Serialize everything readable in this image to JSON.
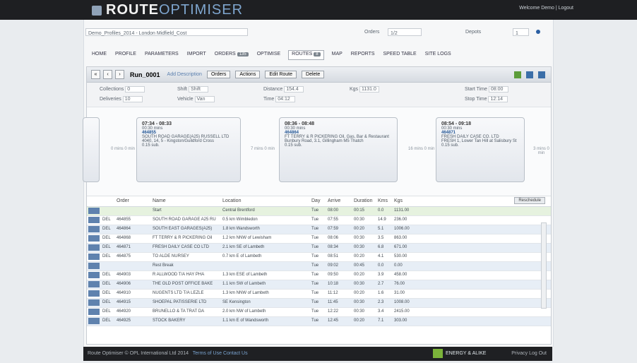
{
  "header": {
    "brand_main": "ROUTE",
    "brand_sub": "OPTIMISER",
    "user_links": "Welcome Demo | Logout"
  },
  "filters": {
    "profile": "Demo_Profiles_2014 - London Midfield_Cost",
    "orders_label": "Orders",
    "orders_value": "1/2",
    "depot_label": "Depots",
    "depot_value": "1"
  },
  "nav": {
    "items": [
      "HOME",
      "PROFILE",
      "PARAMETERS",
      "IMPORT",
      "ORDERS",
      "OPTIMISE",
      "ROUTES",
      "MAP",
      "REPORTS",
      "SPEED TABLE",
      "SITE LOGS"
    ],
    "orders_badge": "135",
    "routes_badge": "8"
  },
  "toolbar": {
    "nav_prev_first": "«",
    "nav_prev": "‹",
    "nav_next": "›",
    "route_title": "Run_0001",
    "sub": "Add Description",
    "buttons": [
      "Orders",
      "Actions",
      "Edit Route",
      "Delete"
    ]
  },
  "summary": {
    "collections_label": "Collections",
    "collections_value": "0",
    "deliveries_label": "Deliveries",
    "deliveries_value": "10",
    "shift_label": "Shift",
    "shift_value": "Shift",
    "vehicle_label": "Vehicle",
    "vehicle_value": "Van",
    "distance_label": "Distance",
    "distance_value": "154.4",
    "time_label": "Time",
    "time_value": "04:12",
    "kgs_label": "Kgs",
    "kgs_value": "1131.0",
    "start_label": "Start Time",
    "start_value": "08:00",
    "stop_label": "Stop Time",
    "stop_value": "12:14"
  },
  "timeline": {
    "stops": [
      {
        "time": "07:34 - 08:33",
        "dur": "00:30 mins",
        "ref": "464855",
        "line1": "SOUTH ROAD GARAGE(A25) RUSSELL LTD",
        "line2": "4040, 14, 5 - Kingston/Guildford Cross",
        "line3": "0.15 sub."
      },
      {
        "time": "08:36 - 08:48",
        "dur": "00:30 mins",
        "ref": "464864",
        "line1": "FT TERRY & R PICKERING Oil, Gas, Bar & Restaurant",
        "line2": "Bunbury Road, 3.1, Gillingham M5 Thatch",
        "line3": "0.15 sub."
      },
      {
        "time": "08:54 - 09:18",
        "dur": "00:30 mins",
        "ref": "464871",
        "line1": "FRESH DAILY CASE CO. LTD",
        "line2": "FRESH 1, Lower Tan Hill at Salisbury St",
        "line3": "0.15 sub."
      }
    ],
    "connectors": [
      "0 mins 0 min",
      "7 mins 0 min",
      "16 mins 0 min",
      "3 mins 0 min"
    ]
  },
  "grid": {
    "headers": [
      "Order",
      "Name",
      "Location",
      "Day",
      "Arrive",
      "Duration",
      "Kms",
      "Kgs"
    ],
    "reschedule": "Reschedule",
    "rows": [
      {
        "type": "",
        "order": "",
        "name": "Start",
        "loc": "Central Brentford",
        "day": "Tue",
        "arrive": "08:00",
        "dur": "00:15",
        "kms": "0.0",
        "kgs": "1131.00"
      },
      {
        "type": "DEL",
        "order": "464855",
        "name": "SOUTH ROAD GARAGE A25 RU",
        "loc": "0.5 km Wimbledon",
        "day": "Tue",
        "arrive": "07:55",
        "dur": "00:30",
        "kms": "14.9",
        "kgs": "236.00"
      },
      {
        "type": "DEL",
        "order": "464864",
        "name": "SOUTH EAST GARAGES(A25)",
        "loc": "1.8 km Wandsworth",
        "day": "Tue",
        "arrive": "07:59",
        "dur": "00:20",
        "kms": "5.1",
        "kgs": "1006.00"
      },
      {
        "type": "DEL",
        "order": "464868",
        "name": "FT TERRY & R PICKERING Oil",
        "loc": "1.2 km NNW of Lewisham",
        "day": "Tue",
        "arrive": "08:06",
        "dur": "00:30",
        "kms": "3.5",
        "kgs": "863.00"
      },
      {
        "type": "DEL",
        "order": "464871",
        "name": "FRESH DAILY CASE CO LTD",
        "loc": "2.1 km SE of Lambeth",
        "day": "Tue",
        "arrive": "08:34",
        "dur": "00:30",
        "kms": "6.8",
        "kgs": "671.00"
      },
      {
        "type": "DEL",
        "order": "464875",
        "name": "TO ALDE NURSEY",
        "loc": "0.7 km E of Lambeth",
        "day": "Tue",
        "arrive": "08:51",
        "dur": "00:20",
        "kms": "4.1",
        "kgs": "530.00"
      },
      {
        "type": "",
        "order": "",
        "name": "Rest Break",
        "loc": "",
        "day": "Tue",
        "arrive": "09:02",
        "dur": "00:45",
        "kms": "0.0",
        "kgs": "0.00"
      },
      {
        "type": "DEL",
        "order": "464903",
        "name": "R ALLWOOD T/A HAY PHA",
        "loc": "1.3 km ESE of Lambeth",
        "day": "Tue",
        "arrive": "09:50",
        "dur": "00:20",
        "kms": "3.9",
        "kgs": "458.00"
      },
      {
        "type": "DEL",
        "order": "464906",
        "name": "THE OLD POST OFFICE BAKE",
        "loc": "1.1 km SW of Lambeth",
        "day": "Tue",
        "arrive": "10:18",
        "dur": "00:30",
        "kms": "2.7",
        "kgs": "76.00"
      },
      {
        "type": "DEL",
        "order": "464910",
        "name": "NUGENTS LTD T/A LEZLE",
        "loc": "1.3 km NNW of Lambeth",
        "day": "Tue",
        "arrive": "11:12",
        "dur": "00:20",
        "kms": "1.6",
        "kgs": "31.00"
      },
      {
        "type": "DEL",
        "order": "464915",
        "name": "SHOEPAL PATISSERIE LTD",
        "loc": "SE Kensington",
        "day": "Tue",
        "arrive": "11:45",
        "dur": "00:30",
        "kms": "2.3",
        "kgs": "1008.00"
      },
      {
        "type": "DEL",
        "order": "464920",
        "name": "BRUNELLO & TA TRAT DA",
        "loc": "2.0 km NW of Lambeth",
        "day": "Tue",
        "arrive": "12:22",
        "dur": "00:30",
        "kms": "3.4",
        "kgs": "2415.00"
      },
      {
        "type": "DEL",
        "order": "464925",
        "name": "STOCK BAKERY",
        "loc": "1.1 km E of Wandsworth",
        "day": "Tue",
        "arrive": "12:45",
        "dur": "00:20",
        "kms": "7.1",
        "kgs": "303.00"
      }
    ]
  },
  "footer": {
    "copyright": "Route Optimiser © OPL International Ltd 2014",
    "links": "Terms of Use  Contact Us",
    "cert": "ENERGY & ALIKE",
    "right": "Privacy   Log Out"
  },
  "colors": {
    "topbar": "#1e1f22",
    "row_alt": "#e7eef6",
    "row_highlight": "#e6f2df",
    "accent": "#5f82ae"
  }
}
